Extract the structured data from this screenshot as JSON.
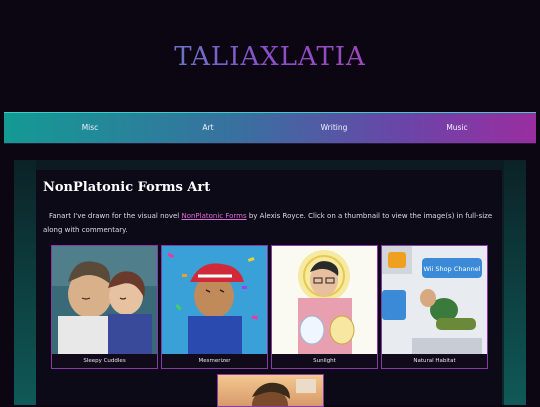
{
  "site": {
    "title": "TALIAXLATIA"
  },
  "nav": {
    "items": [
      "Misc",
      "Art",
      "Writing",
      "Music"
    ]
  },
  "main": {
    "title": "NonPlatonic Forms Art",
    "intro_before": "Fanart I've drawn for the visual novel ",
    "intro_link": "NonPlatonic Forms",
    "intro_after": " by Alexis Royce. Click on a thumbnail to view the image(s) in full-size along with commentary."
  },
  "gallery": {
    "items": [
      {
        "caption": "Sleepy Cuddles"
      },
      {
        "caption": "Mesmerizer"
      },
      {
        "caption": "Sunlight"
      },
      {
        "caption": "Natural Habitat"
      }
    ],
    "wii_label": "Wii Shop Channel"
  }
}
